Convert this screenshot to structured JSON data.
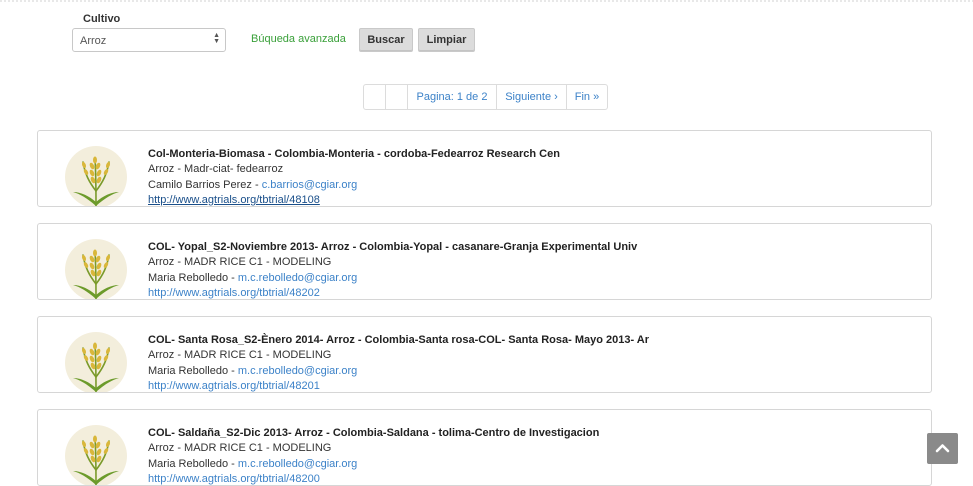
{
  "filter": {
    "label": "Cultivo",
    "selected": "Arroz",
    "advanced_link": "Búqueda avanzada",
    "search_button": "Buscar",
    "clear_button": "Limpiar"
  },
  "pagination": {
    "first": "",
    "prev": "",
    "page_info": "Pagina: 1 de 2",
    "next": "Siguiente ›",
    "last": "Fin »"
  },
  "results": [
    {
      "title": "Col-Monteria-Biomasa - Colombia-Monteria - cordoba-Fedearroz Research Cen",
      "subtitle": "Arroz - Madr-ciat- fedearroz",
      "contact_name": "Camilo Barrios Perez",
      "separator": " - ",
      "email": "c.barrios@cgiar.org",
      "url": "http://www.agtrials.org/tbtrial/48108"
    },
    {
      "title": "COL- Yopal_S2-Noviembre 2013- Arroz - Colombia-Yopal - casanare-Granja Experimental Univ",
      "subtitle": "Arroz - MADR RICE C1 - MODELING",
      "contact_name": "Maria Rebolledo",
      "separator": " - ",
      "email": "m.c.rebolledo@cgiar.org",
      "url": "http://www.agtrials.org/tbtrial/48202"
    },
    {
      "title": "COL- Santa Rosa_S2-Ènero 2014- Arroz - Colombia-Santa rosa-COL- Santa Rosa- Mayo 2013- Ar",
      "subtitle": "Arroz - MADR RICE C1 - MODELING",
      "contact_name": "Maria Rebolledo",
      "separator": " - ",
      "email": "m.c.rebolledo@cgiar.org",
      "url": "http://www.agtrials.org/tbtrial/48201"
    },
    {
      "title": "COL- Saldaña_S2-Dic 2013- Arroz - Colombia-Saldana - tolima-Centro de Investigacion",
      "subtitle": "Arroz - MADR RICE C1 - MODELING",
      "contact_name": "Maria Rebolledo",
      "separator": " - ",
      "email": "m.c.rebolledo@cgiar.org",
      "url": "http://www.agtrials.org/tbtrial/48200"
    }
  ],
  "icons": {
    "crop_logo": "rice-plant-icon",
    "back_to_top": "chevron-up-icon",
    "select_arrows": "sort-arrows-icon"
  },
  "colors": {
    "link": "#3c82c8",
    "advanced_link": "#3aa03a",
    "button_bg": "#dcdcdc",
    "back_to_top_bg": "#8a8a8a",
    "logo_bg": "#f3eedc"
  }
}
